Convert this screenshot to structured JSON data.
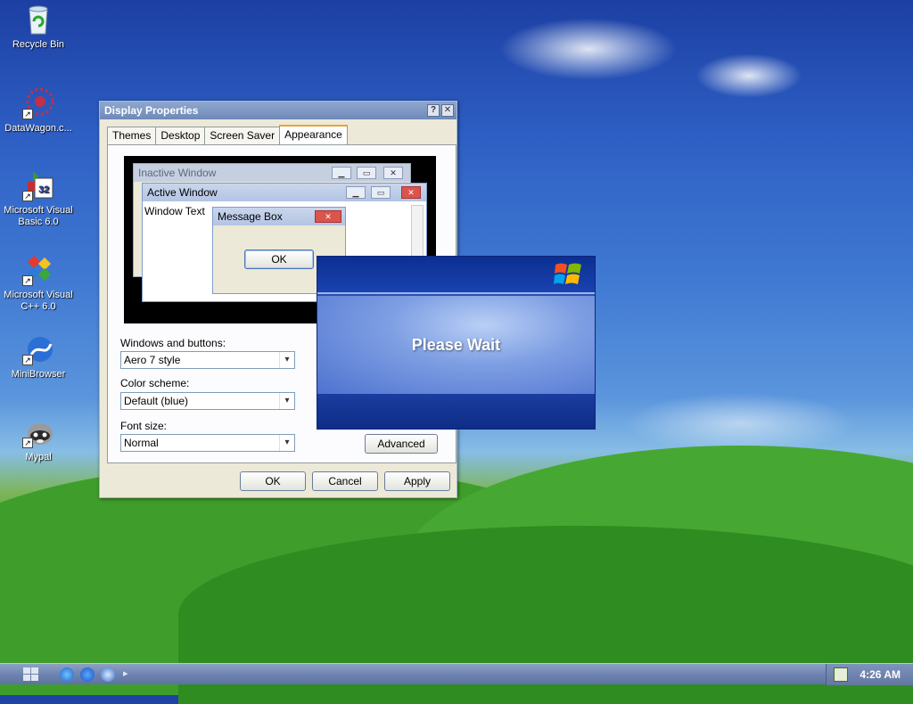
{
  "desktop": {
    "icons": [
      {
        "label": "Recycle Bin"
      },
      {
        "label": "DataWagon.c..."
      },
      {
        "label": "Microsoft Visual Basic 6.0"
      },
      {
        "label": "Microsoft Visual C++ 6.0"
      },
      {
        "label": "MiniBrowser"
      },
      {
        "label": "Mypal"
      }
    ]
  },
  "display_properties": {
    "title": "Display Properties",
    "help_label": "?",
    "close_label": "✕",
    "tabs": [
      "Themes",
      "Desktop",
      "Screen Saver",
      "Appearance"
    ],
    "active_tab": "Appearance",
    "preview": {
      "inactive_title": "Inactive Window",
      "active_title": "Active Window",
      "window_text": "Window Text",
      "message_box_title": "Message Box",
      "message_box_ok": "OK"
    },
    "windows_and_buttons_label": "Windows and buttons:",
    "windows_and_buttons_value": "Aero 7 style",
    "color_scheme_label": "Color scheme:",
    "color_scheme_value": "Default (blue)",
    "font_size_label": "Font size:",
    "font_size_value": "Normal",
    "advanced_label": "Advanced",
    "ok_label": "OK",
    "cancel_label": "Cancel",
    "apply_label": "Apply"
  },
  "splash": {
    "message": "Please Wait"
  },
  "taskbar": {
    "clock": "4:26 AM"
  }
}
